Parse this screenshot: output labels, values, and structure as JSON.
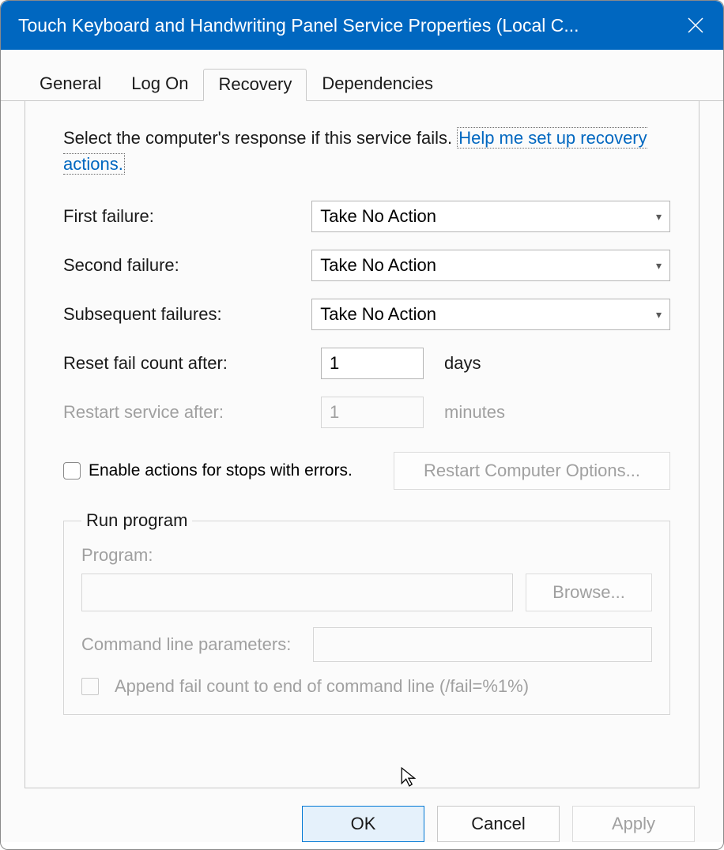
{
  "window": {
    "title": "Touch Keyboard and Handwriting Panel Service Properties (Local C..."
  },
  "tabs": {
    "general": "General",
    "logon": "Log On",
    "recovery": "Recovery",
    "dependencies": "Dependencies"
  },
  "intro": {
    "text": "Select the computer's response if this service fails. ",
    "link": "Help me set up recovery actions."
  },
  "failure": {
    "first_label": "First failure:",
    "first_value": "Take No Action",
    "second_label": "Second failure:",
    "second_value": "Take No Action",
    "subsequent_label": "Subsequent failures:",
    "subsequent_value": "Take No Action"
  },
  "reset": {
    "label": "Reset fail count after:",
    "value": "1",
    "unit": "days"
  },
  "restart": {
    "label": "Restart service after:",
    "value": "1",
    "unit": "minutes"
  },
  "enable_stops": {
    "label": "Enable actions for stops with errors."
  },
  "restart_options_btn": "Restart Computer Options...",
  "run_program": {
    "legend": "Run program",
    "program_label": "Program:",
    "browse": "Browse...",
    "cmd_label": "Command line parameters:",
    "append_label": "Append fail count to end of command line (/fail=%1%)"
  },
  "buttons": {
    "ok": "OK",
    "cancel": "Cancel",
    "apply": "Apply"
  }
}
